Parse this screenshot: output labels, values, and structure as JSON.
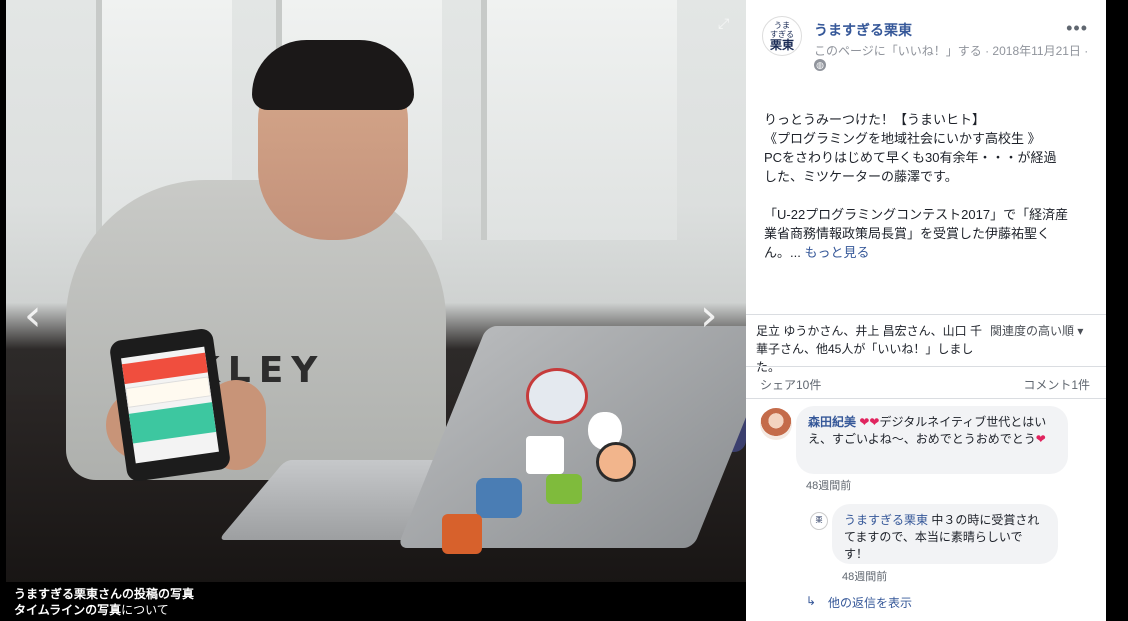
{
  "photo": {
    "caption_line1": "うますぎる栗東さんの投稿の写真",
    "caption_line2_bold": "タイムラインの写真",
    "caption_line2_rest": "について",
    "laptop_logo": "AKLEY"
  },
  "post": {
    "page_name": "うますぎる栗東",
    "meta": "このページに「いいね！」する · 2018年11月21日 ·",
    "avatar_text": {
      "line1": "うま",
      "line2": "すぎる",
      "line3": "栗東"
    },
    "body_lines": [
      "りっとうみーつけた！【うまいヒト】",
      "《プログラミングを地域社会にいかす高校生 》",
      "PCをさわりはじめて早くも30有余年・・・が経過",
      "した、ミツケーターの藤澤です。"
    ],
    "body_lines2": [
      "「U-22プログラミングコンテスト2017」で「経済産",
      "業省商務情報政策局長賞」を受賞した伊藤祐聖く",
      "ん。..."
    ],
    "see_more": "もっと見る"
  },
  "reactions": {
    "likes_text": "足立 ゆうかさん、井上 昌宏さん、山口 千華子さん、他45人が「いいね！」しました。",
    "sort_label": "関連度の高い順 ▾",
    "shares": "シェア10件",
    "comments": "コメント1件"
  },
  "comments": [
    {
      "author": "森田紀美",
      "text": "デジタルネイティブ世代とはいえ、すごいよね～、おめでとうおめでとう",
      "time": "48週間前"
    }
  ],
  "reply": {
    "author": "うますぎる栗東",
    "text": "中３の時に受賞されてますので、本当に素晴らしいです！",
    "time": "48週間前"
  },
  "more_replies": "他の返信を表示",
  "colors": {
    "link": "#365899",
    "meta": "#90949c",
    "bubble": "#f2f3f5"
  }
}
